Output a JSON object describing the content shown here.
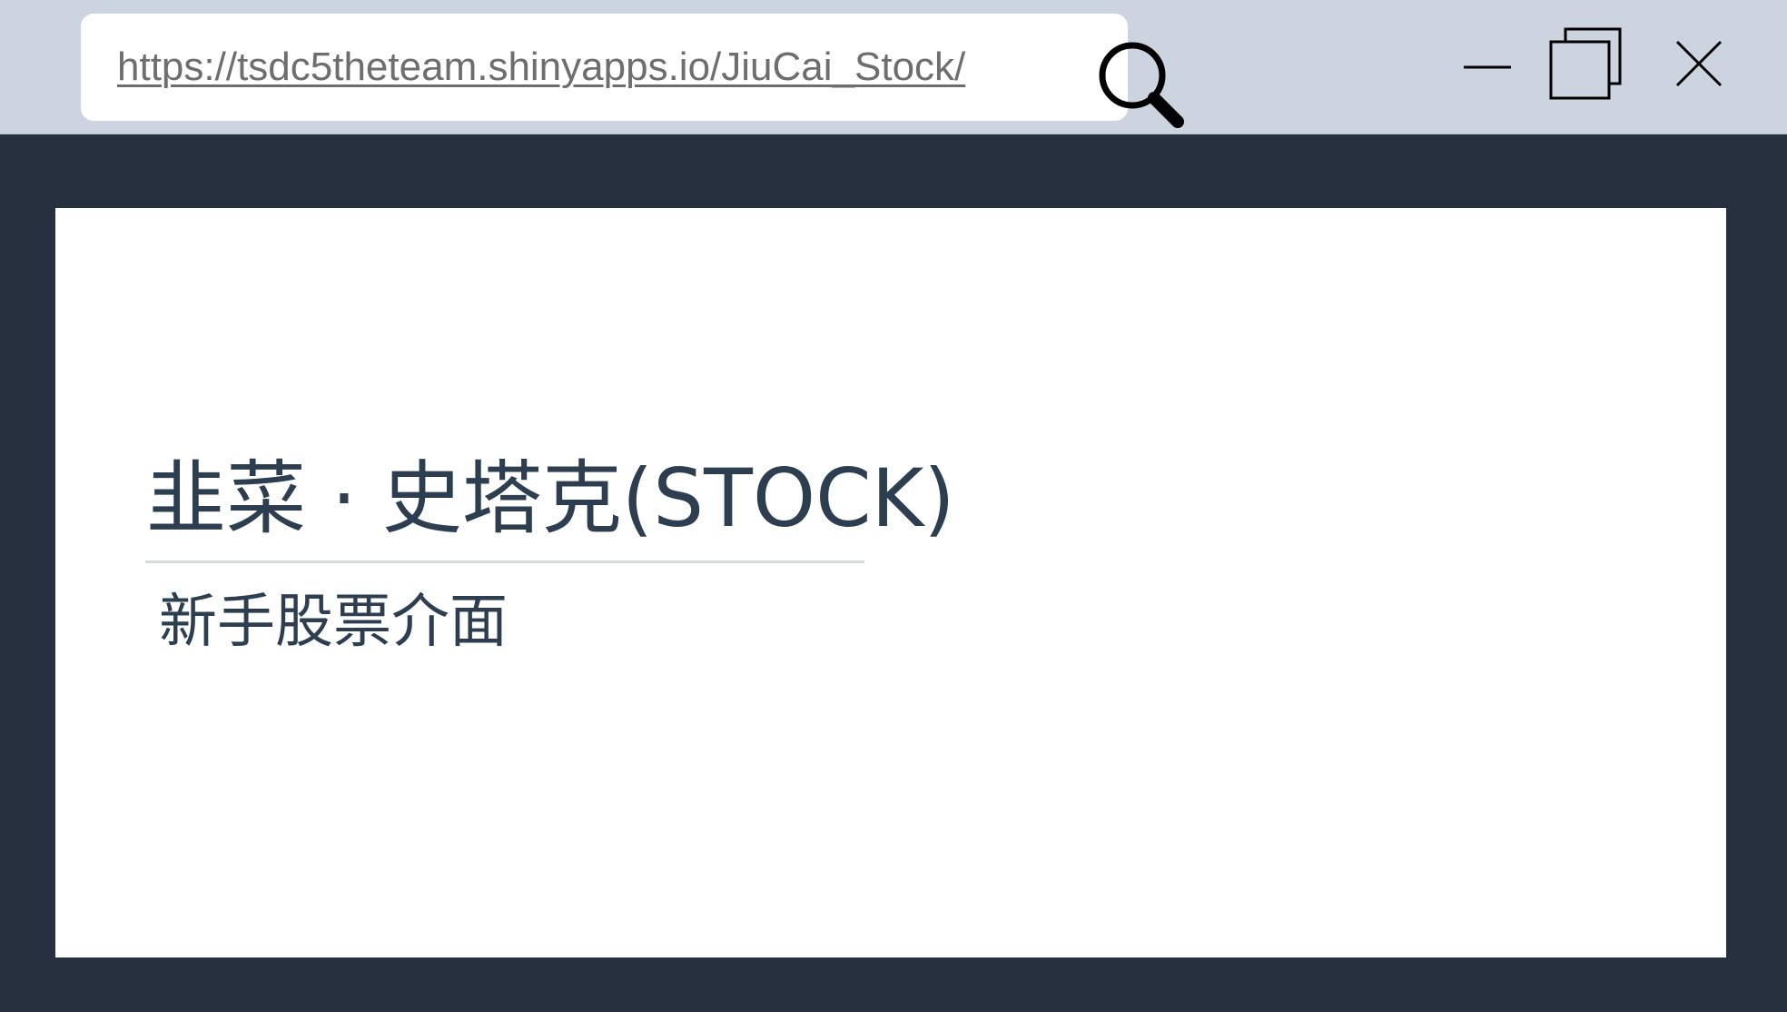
{
  "browser": {
    "url": "https://tsdc5theteam.shinyapps.io/JiuCai_Stock/",
    "icons": {
      "search": "search-icon",
      "minimize": "minimize-icon",
      "maximize": "maximize-icon",
      "close": "close-icon"
    }
  },
  "page": {
    "title": "韭菜 · 史塔克(STOCK)",
    "subtitle": "新手股票介面"
  },
  "colors": {
    "titlebar": "#ccd4df",
    "frame": "#27303f",
    "content_bg": "#ffffff",
    "text": "#2c3e50",
    "url_text": "#6e6e6e"
  }
}
